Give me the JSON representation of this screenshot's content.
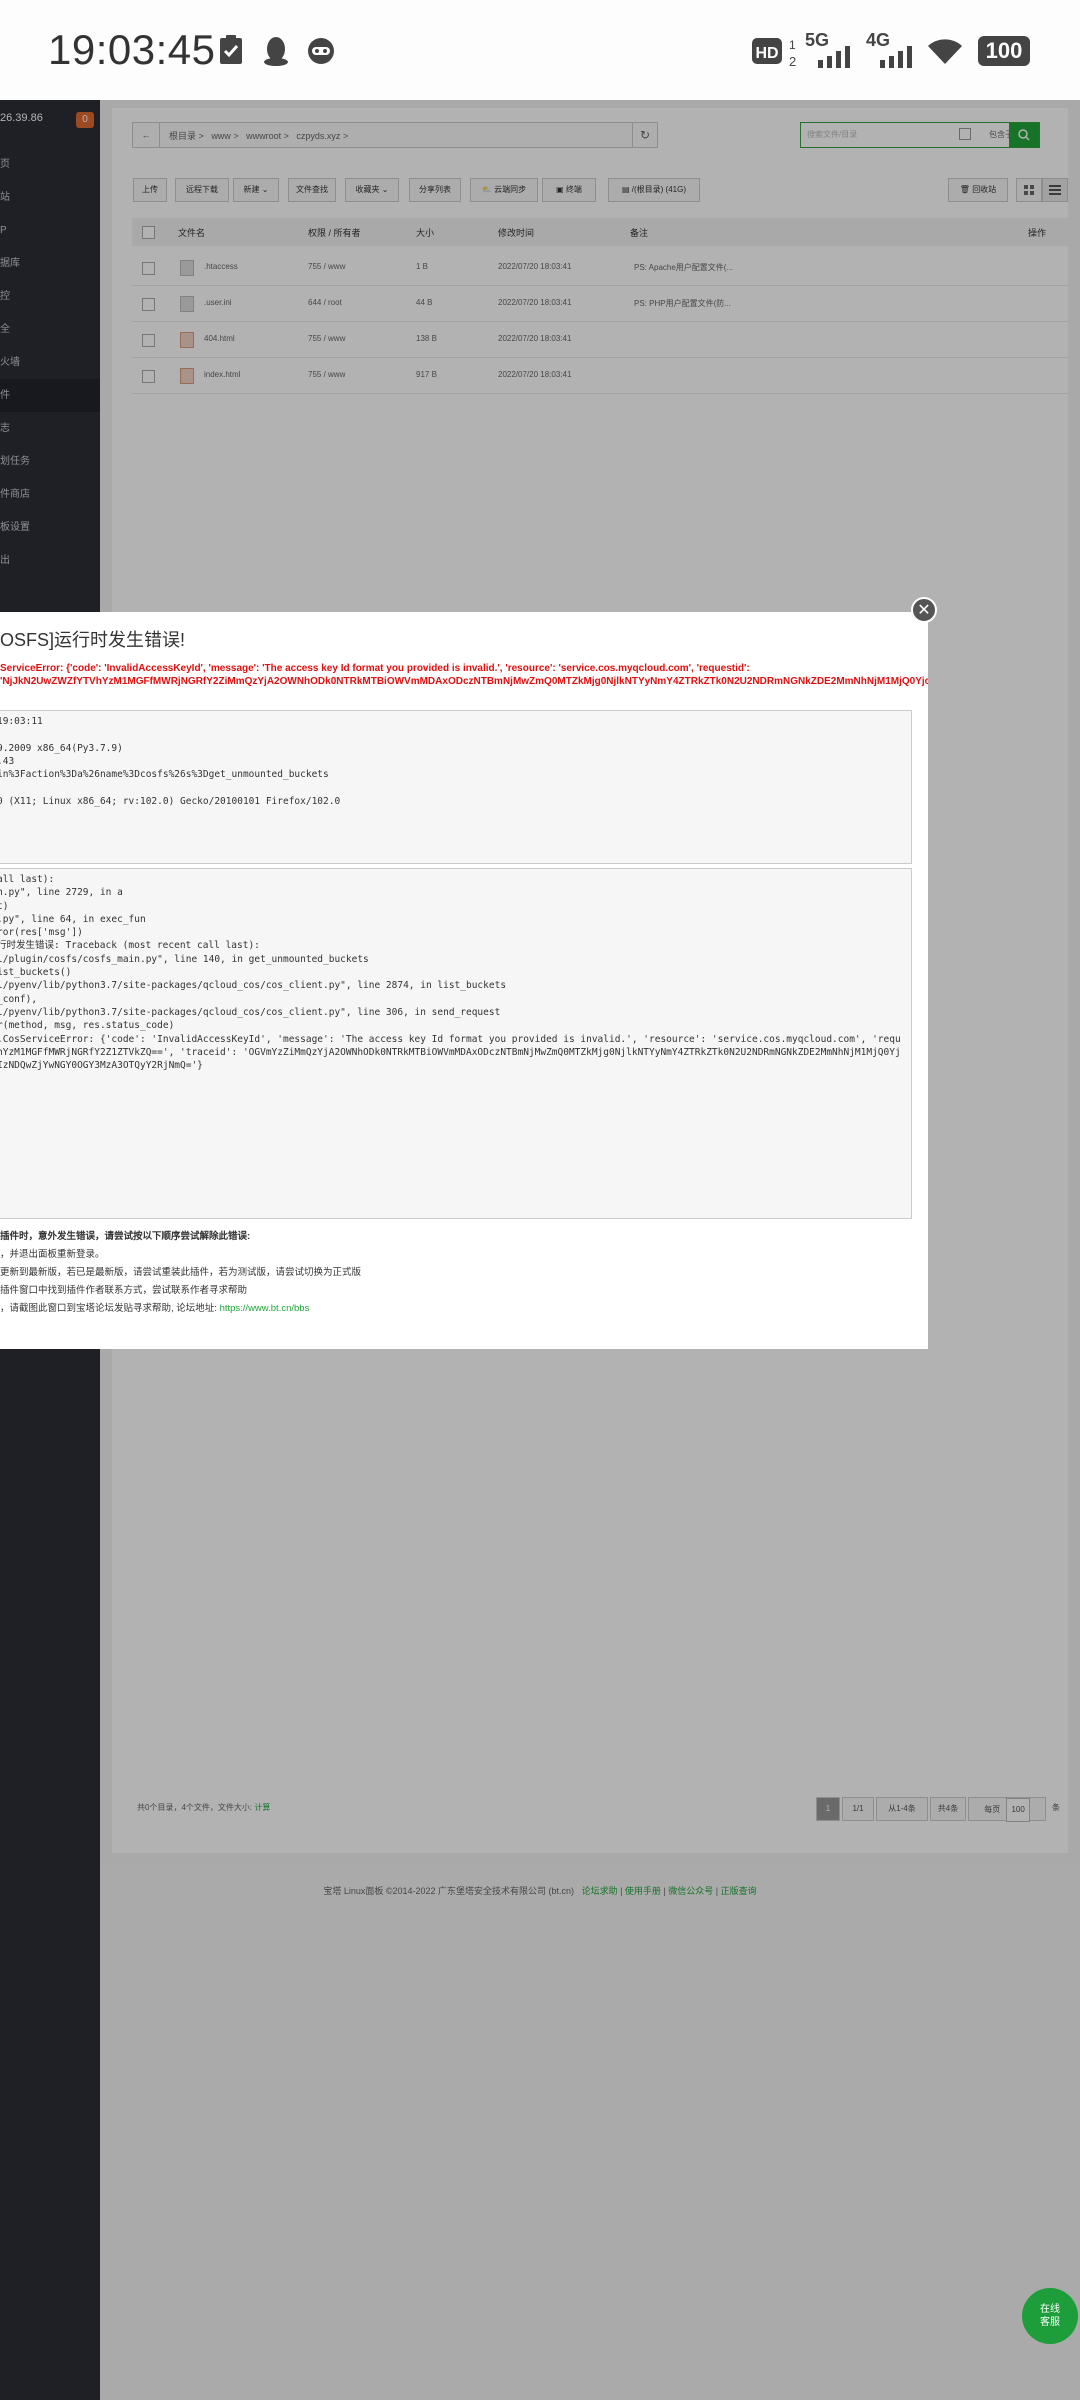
{
  "status_bar": {
    "time": "19:03:45",
    "network_label": "5G",
    "network_label2": "4G",
    "battery": "100"
  },
  "sidebar": {
    "ip": "26.39.86",
    "badge": "0",
    "items": [
      "页",
      "站",
      "P",
      "据库",
      "控",
      "全",
      "火墙",
      "件",
      "志",
      "划任务",
      "件商店",
      "板设置",
      "出"
    ],
    "active_index": 7
  },
  "file_manager": {
    "back": "←",
    "breadcrumb": [
      "根目录",
      ">",
      "www",
      ">",
      "wwwroot",
      ">",
      "czpyds.xyz",
      ">"
    ],
    "refresh": "↻",
    "search_placeholder": "搜索文件/目录",
    "search_option": "包含子目录",
    "toolbar": [
      "上传",
      "远程下载",
      "新建",
      "文件查找",
      "收藏夹",
      "分享列表",
      "云端同步",
      "终端",
      "/(根目录) (41G)"
    ],
    "toolbar_right": [
      "回收站"
    ],
    "columns": [
      "文件名",
      "权限 / 所有者",
      "大小",
      "修改时间",
      "备注",
      "操作"
    ],
    "rows": [
      {
        "name": ".htaccess",
        "perm": "755 / www",
        "size": "1 B",
        "time": "2022/07/20 18:03:41",
        "note": "PS: Apache用户配置文件(..."
      },
      {
        "name": ".user.ini",
        "perm": "644 / root",
        "size": "44 B",
        "time": "2022/07/20 18:03:41",
        "note": "PS: PHP用户配置文件(防..."
      },
      {
        "name": "404.html",
        "perm": "755 / www",
        "size": "138 B",
        "time": "2022/07/20 18:03:41",
        "note": ""
      },
      {
        "name": "index.html",
        "perm": "755 / www",
        "size": "917 B",
        "time": "2022/07/20 18:03:41",
        "note": ""
      }
    ],
    "summary": "共0个目录，4个文件，文件大小:",
    "summary_link": "计算",
    "pager": {
      "current": "1",
      "total": "1/1",
      "range": "从1-4条",
      "count": "共4条",
      "per_page_label": "每页",
      "per_page": "100",
      "unit": "条"
    }
  },
  "footer": {
    "copyright": "宝塔 Linux面板 ©2014-2022 广东堡塔安全技术有限公司 (bt.cn)",
    "links": [
      "论坛求助",
      "使用手册",
      "微信公众号",
      "正版查询"
    ]
  },
  "dialog": {
    "title": "OSFS]运行时发生错误!",
    "error": "ServiceError: {'code': 'InvalidAccessKeyId', 'message': 'The access key Id format you provided is invalid.', 'resource': 'service.cos.myqcloud.com', 'requestid': 'NjJkN2UwZWZfYTVhYzM1MGFfMWRjNGRfY2ZiMmQzYjA2OWNhODk0NTRkMTBiOWVmMDAxODczNTBmNjMwZmQ0MTZkMjg0NjlkNTYyNmY4ZTRkZTk0N2U2NDRmNGNkZDE2MmNhNjM1MjQ0Yjc0NDk1MWUyNjBiODEwYzQzMWIzNDQwZjYwN",
    "error_tail": "}",
    "env_lines": [
      "19:03:11",
      "",
      "9.2009 x86_64(Py3.7.9)",
      ".43",
      "in%3Faction%3Da%26name%3Dcosfs%26s%3Dget_unmounted_buckets",
      "",
      "0 (X11; Linux x86_64; rv:102.0) Gecko/20100101 Firefox/102.0"
    ],
    "trace_lines": [
      "all last):",
      "n.py\", line 2729, in a",
      "t)",
      ".py\", line 64, in exec_fun",
      "ror(res['msg'])",
      "行时发生错误: Traceback (most recent call last):",
      "l/plugin/cosfs/cosfs_main.py\", line 140, in get_unmounted_buckets",
      "ist_buckets()",
      "l/pyenv/lib/python3.7/site-packages/qcloud_cos/cos_client.py\", line 2874, in list_buckets",
      "_conf),",
      "l/pyenv/lib/python3.7/site-packages/qcloud_cos/cos_client.py\", line 306, in send_request",
      "r(method, msg, res.status_code)",
      ".CosServiceError: {'code': 'InvalidAccessKeyId', 'message': 'The access key Id format you provided is invalid.', 'resource': 'service.cos.myqcloud.com', 'requ",
      "hYzM1MGFfMWRjNGRfY2Z1ZTVkZQ==', 'traceid': 'OGVmYzZiMmQzYjA2OWNhODk0NTRkMTBiOWVmMDAxODczNTBmNjMwZmQ0MTZkMjg0NjlkNTYyNmY4ZTRkZTk0N2U2NDRmNGNkZDE2MmNhNjM1MjQ0Yj",
      "IzNDQwZjYwNGY0OGY3MzA3OTQyY2RjNmQ='}"
    ],
    "help_title": "插件时，意外发生错误，请尝试按以下顺序尝试解除此错误:",
    "help_items": [
      "，并退出面板重新登录。",
      "更新到最新版，若已是最新版，请尝试重装此插件，若为测试版，请尝试切换为正式版",
      "插件窗口中找到插件作者联系方式，尝试联系作者寻求帮助",
      "，请截图此窗口到宝塔论坛发贴寻求帮助, 论坛地址:"
    ],
    "forum_link": "https://www.bt.cn/bbs"
  },
  "service_button": "在线\n客服",
  "colors": {
    "accent": "#20a53a",
    "error": "#e01010",
    "sidebar": "#2b2f36"
  }
}
